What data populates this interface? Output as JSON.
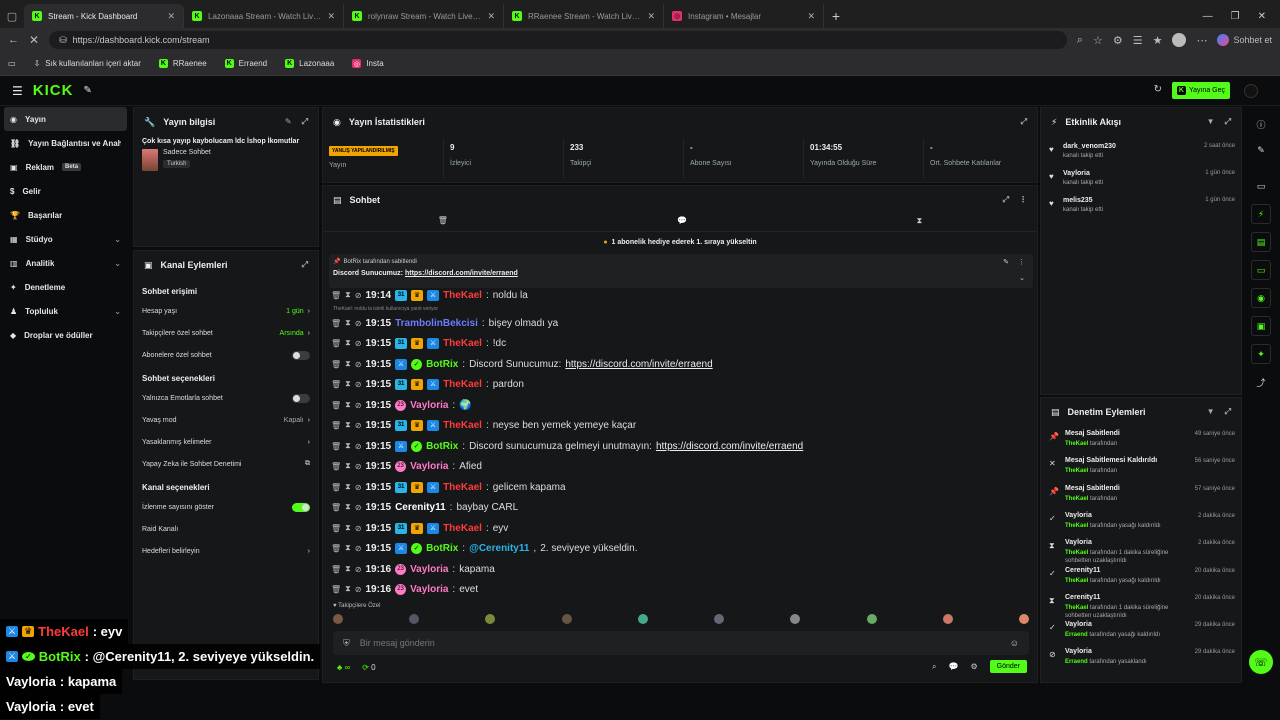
{
  "browser": {
    "tabs": [
      {
        "title": "Stream - Kick Dashboard",
        "active": true,
        "icon": "kick"
      },
      {
        "title": "Lazonaaa Stream - Watch Live on Kick",
        "active": false,
        "icon": "kick"
      },
      {
        "title": "rolynraw Stream - Watch Live on Kick",
        "active": false,
        "icon": "kick"
      },
      {
        "title": "RRaenee Stream - Watch Live on Kick",
        "active": false,
        "icon": "kick"
      },
      {
        "title": "Instagram • Mesajlar",
        "active": false,
        "icon": "instagram"
      }
    ],
    "url": "https://dashboard.kick.com/stream",
    "profile_label": "Sohbet et",
    "bookmarks": [
      "Sık kullanılanları içeri aktar",
      "RRaenee",
      "Erraend",
      "Lazonaaa",
      "Insta"
    ]
  },
  "header": {
    "logo": "KICK",
    "golive_label": "Yayına Geç"
  },
  "nav": [
    {
      "label": "Yayın",
      "icon": "stream-icon",
      "active": true
    },
    {
      "label": "Yayın Bağlantısı ve Anahtarı",
      "icon": "link-icon"
    },
    {
      "label": "Reklam",
      "icon": "ad-icon",
      "badge": "Beta"
    },
    {
      "label": "Gelir",
      "icon": "money-icon"
    },
    {
      "label": "Başarılar",
      "icon": "trophy-icon"
    },
    {
      "label": "Stüdyo",
      "icon": "studio-icon",
      "chevron": true
    },
    {
      "label": "Analitik",
      "icon": "analytics-icon",
      "chevron": true
    },
    {
      "label": "Denetleme",
      "icon": "moderation-icon"
    },
    {
      "label": "Topluluk",
      "icon": "community-icon",
      "chevron": true
    },
    {
      "label": "Droplar ve ödüller",
      "icon": "drops-icon"
    }
  ],
  "stream_info": {
    "title": "Yayın bilgisi",
    "stream_title": "Çok kısa yayıp kaybolucam ldc İshop İkomutlar",
    "category": "Sadece Sohbet",
    "language": "Turkish"
  },
  "channel_actions": {
    "title": "Kanal Eylemleri",
    "chat_access": "Sohbet erişimi",
    "account_age": {
      "label": "Hesap yaşı",
      "value": "1 gün"
    },
    "followers_only": {
      "label": "Takipçilere özel sohbet",
      "value": "Arsında"
    },
    "subs_only": "Abonelere özel sohbet",
    "chat_options": "Sohbet seçenekleri",
    "emotes_only": "Yalnızca Emotlarla sohbet",
    "slow_mode": {
      "label": "Yavaş mod",
      "value": "Kapalı"
    },
    "banned_words": "Yasaklanmış kelimeler",
    "ai_moderation": "Yapay Zeka ile Sohbet Denetimi",
    "channel_options": "Kanal seçenekleri",
    "show_viewers": "İzlenme sayısını göster",
    "raid": "Raid Kanalı",
    "goals": "Hedefleri belirleyin"
  },
  "stats": {
    "title": "Yayın İstatistikleri",
    "misconfigured": "YANLIŞ YAPILANDIRILMIŞ",
    "cells": [
      {
        "value": "",
        "label": "Yayın"
      },
      {
        "value": "9",
        "label": "İzleyici"
      },
      {
        "value": "233",
        "label": "Takipçi"
      },
      {
        "value": "-",
        "label": "Abone Sayısı"
      },
      {
        "value": "01:34:55",
        "label": "Yayında Olduğu Süre"
      },
      {
        "value": "-",
        "label": "Ort. Sohbete Katılanlar"
      }
    ]
  },
  "chat": {
    "title": "Sohbet",
    "gift_banner": "1 abonelik hediye ederek 1. sıraya yükseltin",
    "pinned_by": "BotRix tarafından sabitlendi",
    "pinned_text": "Discord Sunucumuz:",
    "pinned_link": "https://discord.com/invite/erraend",
    "reply_hint": "TheKael: noldu la isimli kullanıcıya yanıt veriyor",
    "messages": [
      {
        "time": "19:14",
        "user": "TheKael",
        "color": "#ff3b3b",
        "badges": [
          "sub",
          "crown",
          "mod"
        ],
        "text": "noldu la"
      },
      {
        "time": "19:15",
        "user": "TrambolinBekcisi",
        "color": "#6c7cff",
        "badges": [],
        "text": "bişey olmadı ya"
      },
      {
        "time": "19:15",
        "user": "TheKael",
        "color": "#ff3b3b",
        "badges": [
          "sub",
          "crown",
          "mod"
        ],
        "text": "!dc"
      },
      {
        "time": "19:15",
        "user": "BotRix",
        "color": "#53fc18",
        "badges": [
          "mod",
          "ver"
        ],
        "text": "Discord Sunucumuz: ",
        "link": "https://discord.com/invite/erraend"
      },
      {
        "time": "19:15",
        "user": "TheKael",
        "color": "#ff3b3b",
        "badges": [
          "sub",
          "crown",
          "mod"
        ],
        "text": "pardon"
      },
      {
        "time": "19:15",
        "user": "Vayloria",
        "color": "#ff7ac6",
        "badges": [
          "gift"
        ],
        "text": "🌍"
      },
      {
        "time": "19:15",
        "user": "TheKael",
        "color": "#ff3b3b",
        "badges": [
          "sub",
          "crown",
          "mod"
        ],
        "text": "neyse ben yemek yemeye kaçar"
      },
      {
        "time": "19:15",
        "user": "BotRix",
        "color": "#53fc18",
        "badges": [
          "mod",
          "ver"
        ],
        "text": "Discord sunucumuza gelmeyi unutmayın: ",
        "link": "https://discord.com/invite/erraend"
      },
      {
        "time": "19:15",
        "user": "Vayloria",
        "color": "#ff7ac6",
        "badges": [
          "gift"
        ],
        "text": "Afied"
      },
      {
        "time": "19:15",
        "user": "TheKael",
        "color": "#ff3b3b",
        "badges": [
          "sub",
          "crown",
          "mod"
        ],
        "text": "gelicem kapama"
      },
      {
        "time": "19:15",
        "user": "Cerenity11",
        "color": "#ffffff",
        "badges": [],
        "text": "baybay CARL"
      },
      {
        "time": "19:15",
        "user": "TheKael",
        "color": "#ff3b3b",
        "badges": [
          "sub",
          "crown",
          "mod"
        ],
        "text": "eyv"
      },
      {
        "time": "19:15",
        "user": "BotRix",
        "color": "#53fc18",
        "badges": [
          "mod",
          "ver"
        ],
        "text": "2. seviyeye yükseldin.",
        "mention": "@Cerenity11"
      },
      {
        "time": "19:16",
        "user": "Vayloria",
        "color": "#ff7ac6",
        "badges": [
          "gift"
        ],
        "text": "kapama"
      },
      {
        "time": "19:16",
        "user": "Vayloria",
        "color": "#ff7ac6",
        "badges": [
          "gift"
        ],
        "text": "evet"
      }
    ],
    "followers_only_label": "Takipçilere Özel",
    "input_placeholder": "Bir mesaj gönderin",
    "send_label": "Gönder",
    "points": "0",
    "infinity": "∞"
  },
  "activity": {
    "title": "Etkinlik Akışı",
    "items": [
      {
        "name": "dark_venom230",
        "sub": "kanalı takip etti",
        "time": "2 saat önce"
      },
      {
        "name": "Vayloria",
        "sub": "kanalı takip etti",
        "time": "1 gün önce"
      },
      {
        "name": "melis235",
        "sub": "kanalı takip etti",
        "time": "1 gün önce"
      }
    ]
  },
  "moderation": {
    "title": "Denetim Eylemleri",
    "items": [
      {
        "icon": "pin-icon",
        "title": "Mesaj Sabitlendi",
        "by": "TheKael",
        "rest": " tarafından",
        "time": "49 saniye önce"
      },
      {
        "icon": "unpin-icon",
        "title": "Mesaj Sabitlemesi Kaldırıldı",
        "by": "TheKael",
        "rest": " tarafından",
        "time": "56 saniye önce"
      },
      {
        "icon": "pin-icon",
        "title": "Mesaj Sabitlendi",
        "by": "TheKael",
        "rest": " tarafından",
        "time": "57 saniye önce"
      },
      {
        "icon": "unban-icon",
        "title": "Vayloria",
        "by": "TheKael",
        "rest": " tarafından yasağı kaldırıldı",
        "time": "2 dakika önce"
      },
      {
        "icon": "timeout-icon",
        "title": "Vayloria",
        "by": "TheKael",
        "rest": " tarafından 1 dakika süreliğine sohbetten uzaklaştırıldı",
        "time": "2 dakika önce"
      },
      {
        "icon": "unban-icon",
        "title": "Cerenity11",
        "by": "TheKael",
        "rest": " tarafından yasağı kaldırıldı",
        "time": "20 dakika önce"
      },
      {
        "icon": "timeout-icon",
        "title": "Cerenity11",
        "by": "TheKael",
        "rest": " tarafından 1 dakika süreliğine sohbetten uzaklaştırıldı",
        "time": "20 dakika önce"
      },
      {
        "icon": "unban-icon",
        "title": "Vayloria",
        "by": "Erraend",
        "rest": " tarafından yasağı kaldırıldı",
        "time": "29 dakika önce"
      },
      {
        "icon": "ban-icon",
        "title": "Vayloria",
        "by": "Erraend",
        "rest": " tarafından yasaklandı",
        "time": "29 dakika önce"
      }
    ]
  },
  "overlay": [
    {
      "user": "TheKael",
      "color": "#ff3b3b",
      "text": ": eyv",
      "badges": [
        "mod",
        "crown"
      ]
    },
    {
      "user": "BotRix",
      "color": "#53fc18",
      "text": ": @Cerenity11, 2. seviyeye yükseldin.",
      "badges": [
        "mod",
        "ver"
      ]
    },
    {
      "user": "Vayloria",
      "color": "#ffffff",
      "text": " : kapama",
      "badges": []
    },
    {
      "user": "Vayloria",
      "color": "#ffffff",
      "text": " : evet",
      "badges": []
    }
  ],
  "colors": {
    "accent": "#53fc18",
    "panel": "#161718",
    "bg": "#0b0c0d"
  }
}
